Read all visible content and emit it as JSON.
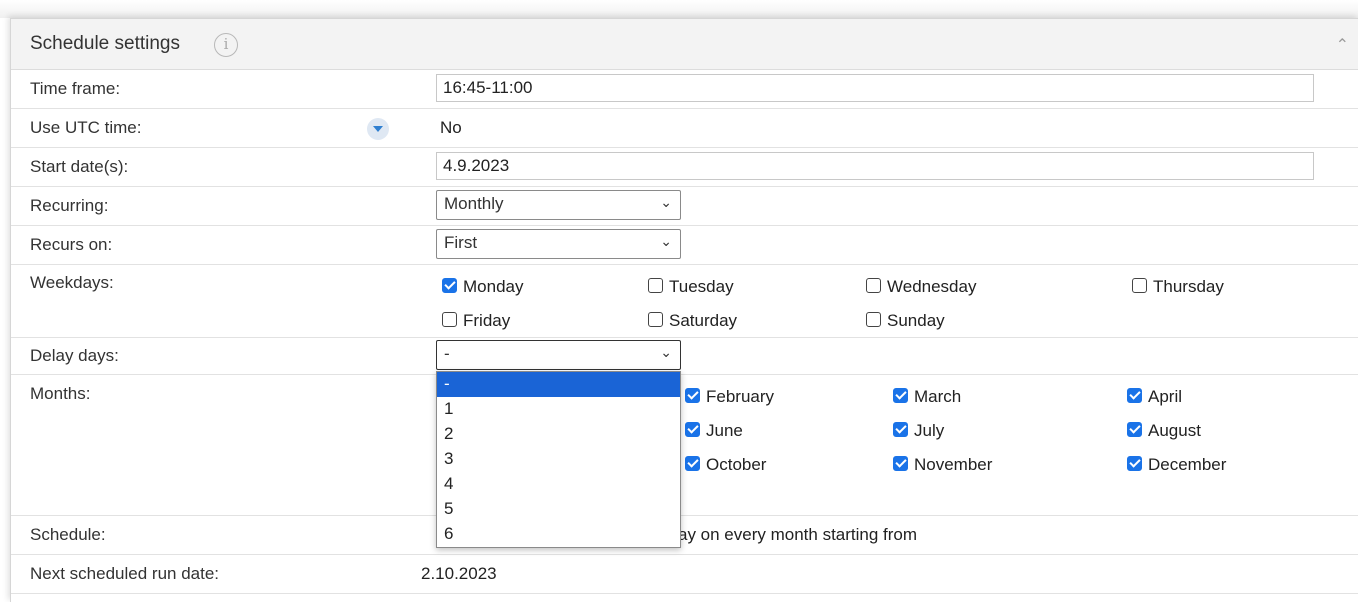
{
  "header": {
    "title": "Schedule settings"
  },
  "fields": {
    "time_frame": {
      "label": "Time frame:",
      "value": "16:45-11:00"
    },
    "use_utc": {
      "label": "Use UTC time:",
      "value": "No"
    },
    "start_date": {
      "label": "Start date(s):",
      "value": "4.9.2023"
    },
    "recurring": {
      "label": "Recurring:",
      "value": "Monthly"
    },
    "recurs_on": {
      "label": "Recurs on:",
      "value": "First"
    },
    "weekdays": {
      "label": "Weekdays:",
      "items": [
        {
          "label": "Monday",
          "checked": true
        },
        {
          "label": "Tuesday",
          "checked": false
        },
        {
          "label": "Wednesday",
          "checked": false
        },
        {
          "label": "Thursday",
          "checked": false
        },
        {
          "label": "Friday",
          "checked": false
        },
        {
          "label": "Saturday",
          "checked": false
        },
        {
          "label": "Sunday",
          "checked": false
        }
      ]
    },
    "delay_days": {
      "label": "Delay days:",
      "value": "-",
      "options": [
        "-",
        "1",
        "2",
        "3",
        "4",
        "5",
        "6"
      ]
    },
    "months": {
      "label": "Months:",
      "items": [
        {
          "label": "February",
          "checked": true
        },
        {
          "label": "March",
          "checked": true
        },
        {
          "label": "April",
          "checked": true
        },
        {
          "label": "June",
          "checked": true
        },
        {
          "label": "July",
          "checked": true
        },
        {
          "label": "August",
          "checked": true
        },
        {
          "label": "October",
          "checked": true
        },
        {
          "label": "November",
          "checked": true
        },
        {
          "label": "December",
          "checked": true
        }
      ]
    },
    "schedule": {
      "label": "Schedule:",
      "text": "ay on every month starting from"
    },
    "next_run": {
      "label": "Next scheduled run date:",
      "value": "2.10.2023"
    }
  },
  "colors": {
    "accent": "#1a73e8",
    "selected_option": "#1a64d6"
  }
}
